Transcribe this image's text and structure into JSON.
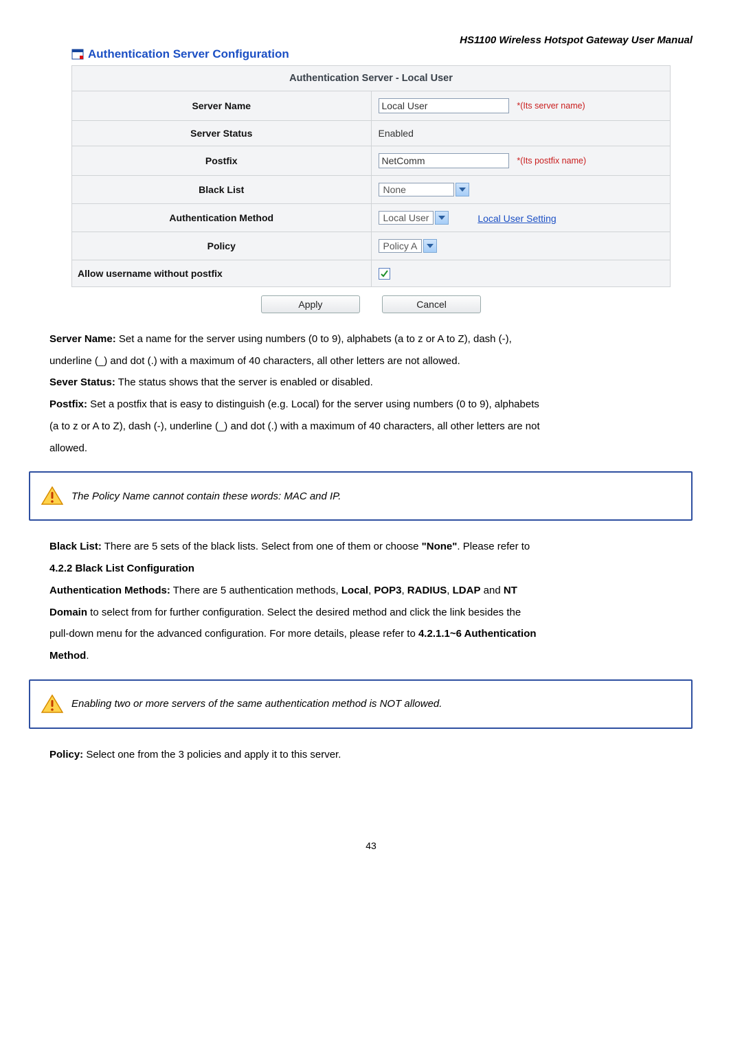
{
  "header": {
    "doc_title": "HS1100 Wireless Hotspot Gateway User Manual"
  },
  "section": {
    "title": "Authentication Server Configuration"
  },
  "table": {
    "title": "Authentication Server - Local User",
    "rows": {
      "server_name": {
        "label": "Server Name",
        "value": "Local User",
        "hint": "*(Its server name)"
      },
      "server_status": {
        "label": "Server Status",
        "value": "Enabled"
      },
      "postfix": {
        "label": "Postfix",
        "value": "NetComm",
        "hint": "*(Its postfix name)"
      },
      "black_list": {
        "label": "Black List",
        "value": "None"
      },
      "auth_method": {
        "label": "Authentication Method",
        "value": "Local User",
        "link": "Local User Setting"
      },
      "policy": {
        "label": "Policy",
        "value": "Policy A"
      },
      "allow_user": {
        "label": "Allow username without postfix",
        "checked": true
      }
    }
  },
  "buttons": {
    "apply": "Apply",
    "cancel": "Cancel"
  },
  "desc": {
    "server_name_title": "Server Name:",
    "server_name_body1": " Set a name for the server using numbers (0 to 9), alphabets (a to z or A to Z), dash (-),",
    "server_name_body2": "underline (_) and dot (.) with a maximum of 40 characters, all other letters are not allowed.",
    "server_status_title": "Sever Status:",
    "server_status_body": " The status shows that the server is enabled or disabled.",
    "postfix_title": "Postfix:",
    "postfix_body1": " Set a postfix that is easy to distinguish (e.g. Local) for the server using numbers (0 to 9), alphabets",
    "postfix_body2": "(a to z or A to Z), dash (-), underline (_) and dot (.) with a maximum of 40 characters, all other letters are not",
    "postfix_body3": "allowed.",
    "note1": "The Policy Name cannot contain these words: MAC and IP.",
    "black_list_title": "Black List:",
    "black_list_body_pre": " There are 5 sets of the black lists. Select from one of them or choose ",
    "black_list_none": "\"None\"",
    "black_list_body_post": ". Please refer to",
    "black_list_ref": "4.2.2 Black List Configuration",
    "auth_methods_title": "Authentication Methods:",
    "auth_methods_body_pre": " There are 5 authentication methods, ",
    "m_local": "Local",
    "m_pop3": "POP3",
    "m_radius": "RADIUS",
    "m_ldap": "LDAP",
    "m_and": " and ",
    "m_nt": "NT",
    "auth_methods_line2_pre": "Domain",
    "auth_methods_line2_body": " to select from for further configuration. Select the desired method and click the link besides the",
    "auth_methods_line3_pre": "pull-down menu for the advanced configuration. For more details, please refer to ",
    "auth_methods_ref": "4.2.1.1~6 Authentication",
    "auth_methods_line4": "Method",
    "note2": "Enabling two or more servers of the same authentication method is NOT allowed.",
    "policy_title": "Policy:",
    "policy_body": " Select one from the 3 policies and apply it to this server."
  },
  "footer": {
    "page_number": "43"
  }
}
